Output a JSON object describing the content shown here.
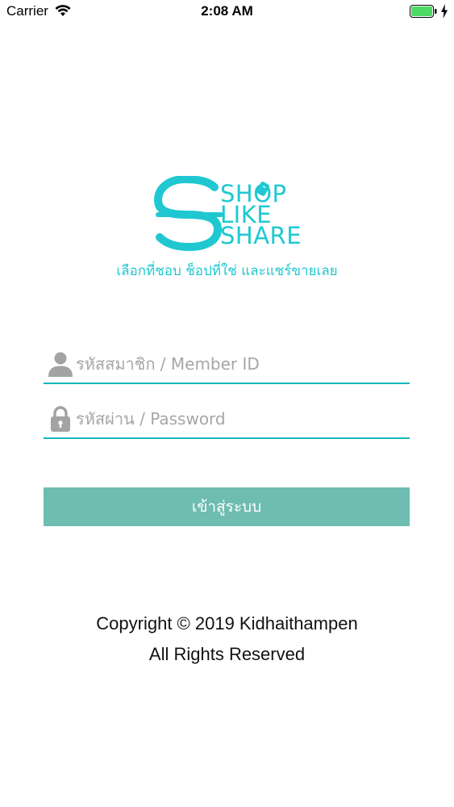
{
  "status_bar": {
    "carrier": "Carrier",
    "time": "2:08 AM",
    "wifi_icon": "wifi-icon",
    "battery_icon": "battery-icon",
    "charging_icon": "charging-bolt-icon"
  },
  "logo": {
    "line1": "SHOP",
    "line2": "LIKE",
    "line3": "SHARE",
    "tagline": "เลือกที่ชอบ ช็อปที่ใช่ และแชร์ขายเลย",
    "color": "#1fc8d1"
  },
  "login_form": {
    "member_id": {
      "placeholder": "รหัสสมาชิก / Member ID",
      "value": "",
      "icon": "user-icon"
    },
    "password": {
      "placeholder": "รหัสผ่าน / Password",
      "value": "",
      "icon": "lock-icon"
    },
    "submit_label": "เข้าสู่ระบบ",
    "button_color": "#6fbcb0",
    "underline_color": "#16b8bb"
  },
  "footer": {
    "copyright_line1": "Copyright © 2019 Kidhaithampen",
    "copyright_line2": "All Rights Reserved"
  }
}
